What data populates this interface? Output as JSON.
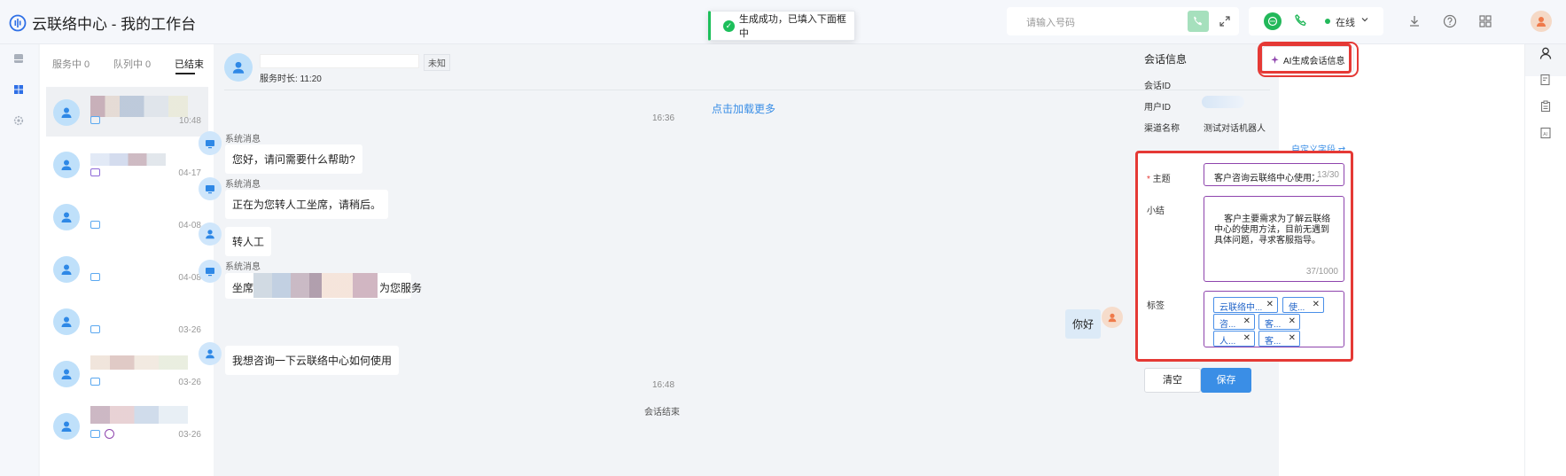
{
  "app": {
    "title": "云联络中心 - 我的工作台"
  },
  "toast": {
    "text": "生成成功，已填入下面框中"
  },
  "topbar": {
    "search_placeholder": "请输入号码",
    "status_label": "在线",
    "status_color": "#22b85a"
  },
  "conversation_tabs": [
    {
      "label": "服务中 0"
    },
    {
      "label": "队列中 0"
    },
    {
      "label": "已结束"
    }
  ],
  "conversations": [
    {
      "time": "10:48"
    },
    {
      "time": "04-17"
    },
    {
      "time": "04-08"
    },
    {
      "time": "04-08"
    },
    {
      "time": "03-26"
    },
    {
      "time": "03-26"
    },
    {
      "time": "03-26"
    }
  ],
  "chat": {
    "customer_tag": "未知",
    "duration": "服务时长: 11:20",
    "load_more": "点击加载更多",
    "time1": "16:36",
    "system_label": "系统消息",
    "messages": [
      {
        "text": "您好，请问需要什么帮助?"
      },
      {
        "text": "正在为您转人工坐席，请稍后。"
      },
      {
        "text": "转人工"
      },
      {
        "text_pre": "坐席",
        "text_post": "为您服务"
      },
      {
        "text": "你好"
      },
      {
        "text": "我想咨询一下云联络中心如何使用"
      }
    ],
    "time2": "16:48",
    "end_label": "会话结束"
  },
  "info": {
    "title": "会话信息",
    "ai_button": "AI生成会话信息",
    "session_id_label": "会话ID",
    "user_id_label": "用户ID",
    "channel_label": "渠道名称",
    "channel_value": "测试对话机器人",
    "custom_fields": "自定义字段",
    "form": {
      "subject_label": "主题",
      "subject_value": "客户咨询云联络中心使用方",
      "subject_count": "13/30",
      "summary_label": "小结",
      "summary_value": "客户主要需求为了解云联络中心的使用方法，目前无遇到具体问题，寻求客服指导。",
      "summary_count": "37/1000",
      "tags_label": "标签",
      "tags": [
        {
          "label": "云联络中..."
        },
        {
          "label": "使..."
        },
        {
          "label": "咨..."
        },
        {
          "label": "客..."
        },
        {
          "label": "人..."
        },
        {
          "label": "客..."
        }
      ]
    },
    "clear_button": "清空",
    "save_button": "保存"
  }
}
